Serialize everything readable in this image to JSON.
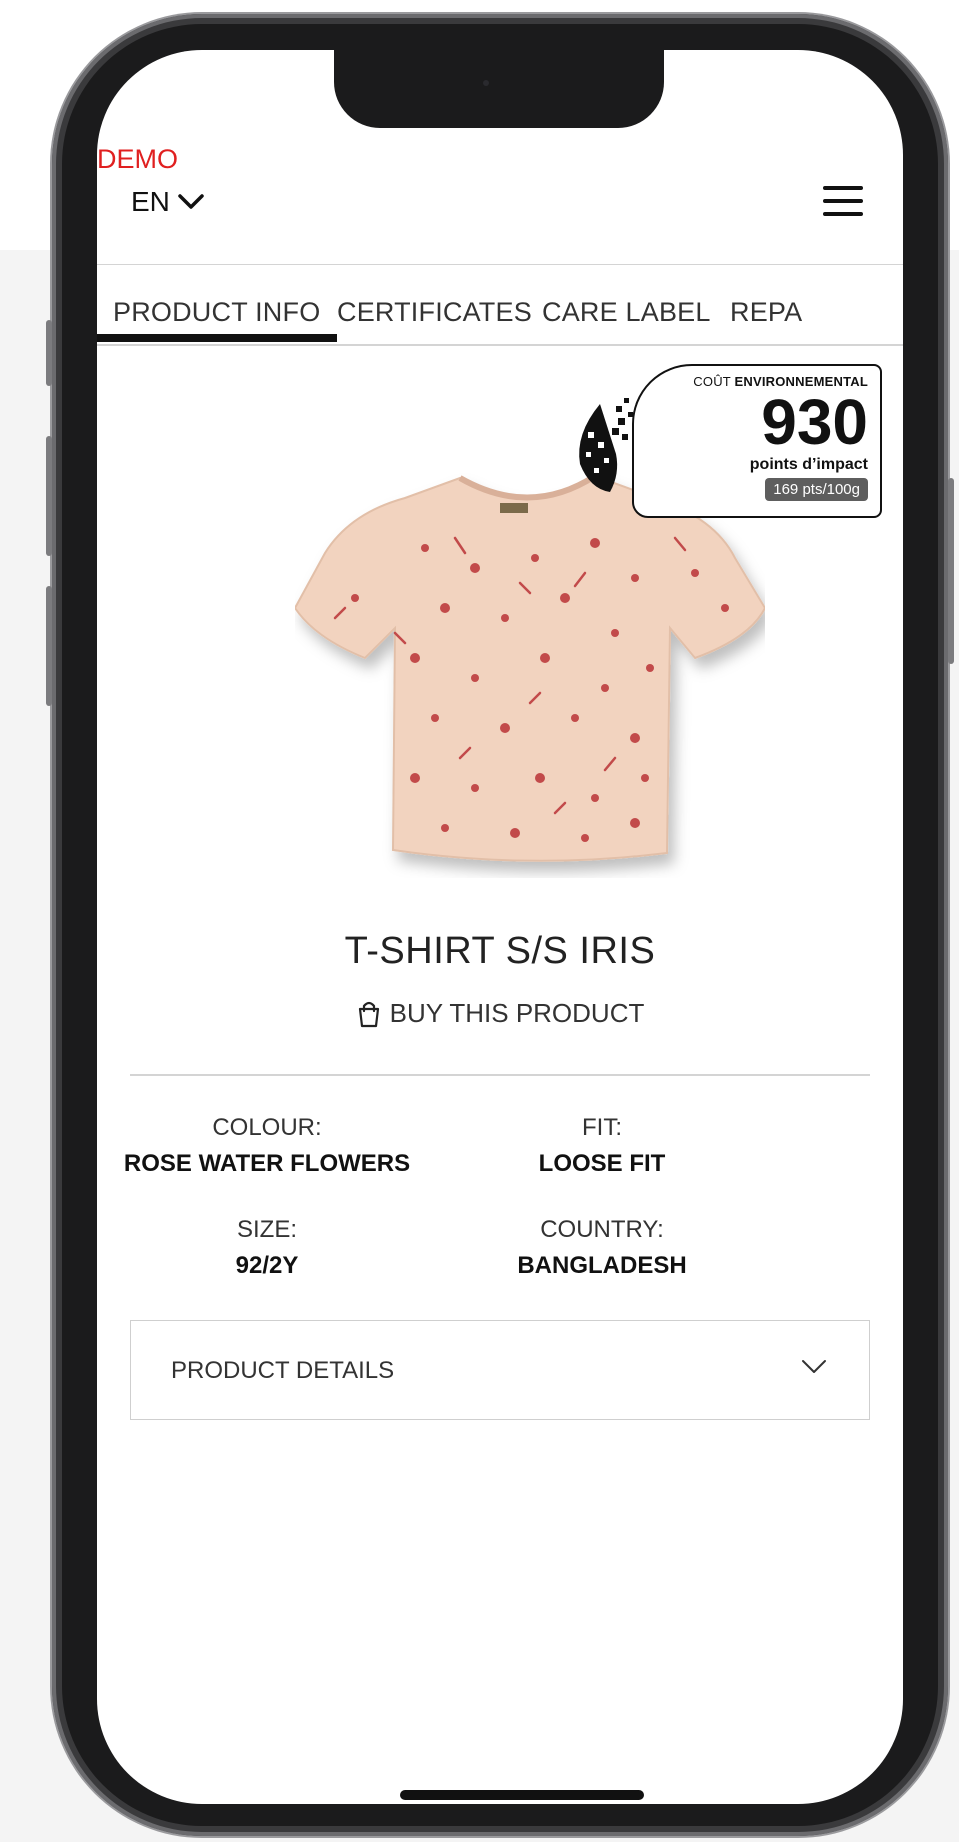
{
  "header": {
    "demo_label": "DEMO",
    "language": "EN"
  },
  "tabs": [
    {
      "label": "PRODUCT INFO",
      "active": true
    },
    {
      "label": "CERTIFICATES"
    },
    {
      "label": "CARE LABEL"
    },
    {
      "label": "REPA"
    }
  ],
  "eco_badge": {
    "title_light": "COÛT ",
    "title_bold": "ENVIRONNEMENTAL",
    "score": "930",
    "unit": "points d’impact",
    "per_weight": "169 pts/100g"
  },
  "product": {
    "name": "T-SHIRT S/S IRIS",
    "buy_label": "BUY THIS PRODUCT",
    "attributes": [
      {
        "label": "COLOUR:",
        "value": "ROSE WATER FLOWERS"
      },
      {
        "label": "FIT:",
        "value": "LOOSE FIT"
      },
      {
        "label": "SIZE:",
        "value": "92/2Y"
      },
      {
        "label": "COUNTRY:",
        "value": "BANGLADESH"
      }
    ],
    "details_label": "PRODUCT DETAILS"
  },
  "colors": {
    "demo": "#e02020",
    "tshirt": "#f2d3bf",
    "print": "#c24a4a"
  }
}
